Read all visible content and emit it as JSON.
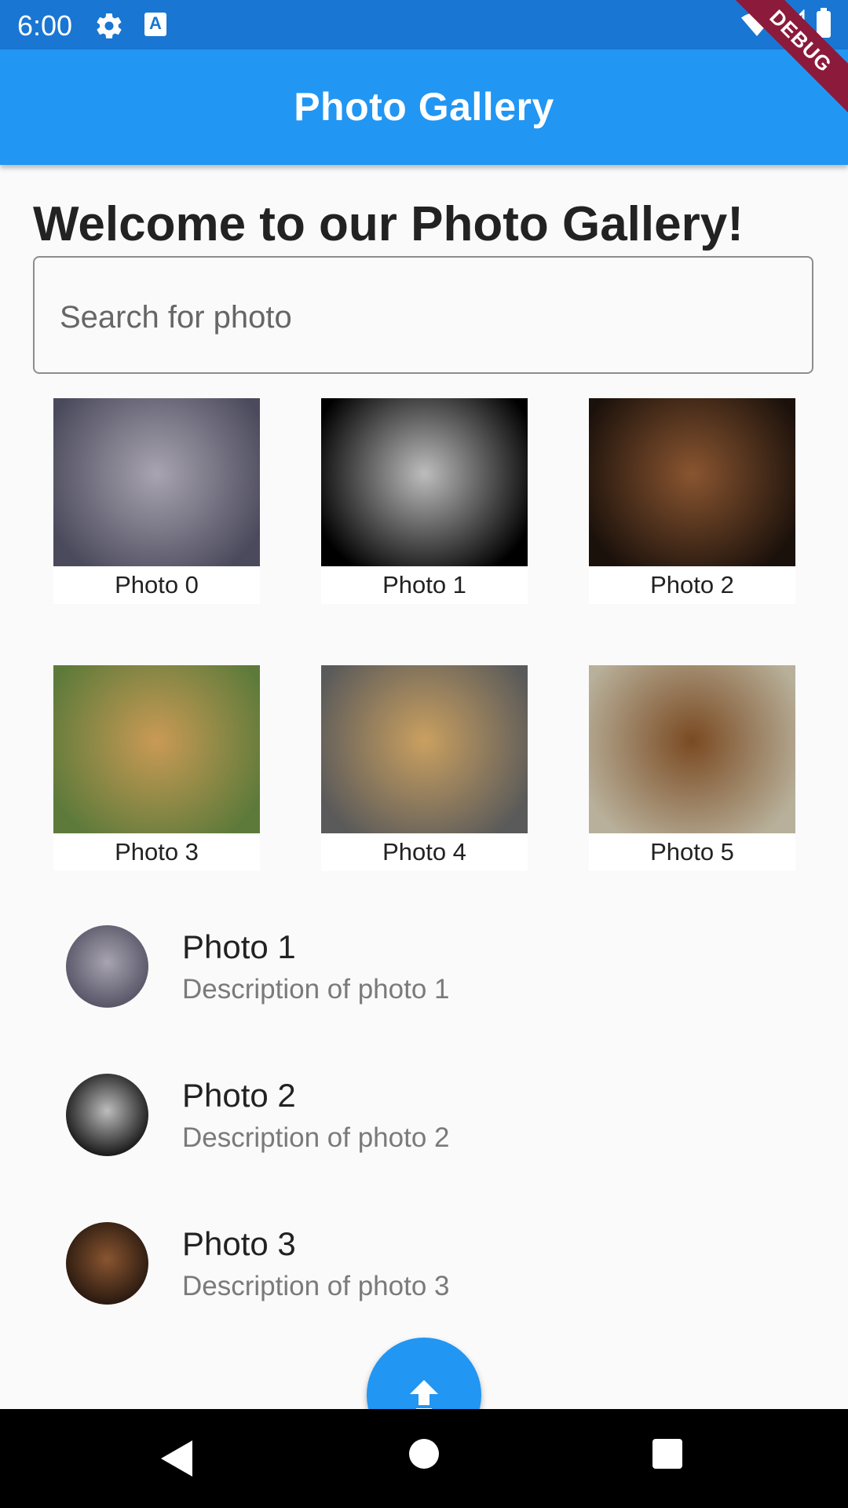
{
  "status_bar": {
    "time": "6:00"
  },
  "app_bar": {
    "title": "Photo Gallery",
    "debug_label": "DEBUG"
  },
  "welcome": "Welcome to our Photo Gallery!",
  "search": {
    "placeholder": "Search for photo",
    "value": ""
  },
  "grid": [
    {
      "label": "Photo 0",
      "tone": [
        "#4b4a5c",
        "#a8a4b0"
      ]
    },
    {
      "label": "Photo 1",
      "tone": [
        "#000000",
        "#bdbdbd"
      ]
    },
    {
      "label": "Photo 2",
      "tone": [
        "#1b110b",
        "#8a5530"
      ]
    },
    {
      "label": "Photo 3",
      "tone": [
        "#5d7a3a",
        "#c99a55"
      ]
    },
    {
      "label": "Photo 4",
      "tone": [
        "#5a5a5a",
        "#caa060"
      ]
    },
    {
      "label": "Photo 5",
      "tone": [
        "#b8b09a",
        "#7a4a22"
      ]
    }
  ],
  "list": [
    {
      "title": "Photo 1",
      "subtitle": "Description of photo 1",
      "tone": [
        "#4b4a5c",
        "#a8a4b0"
      ]
    },
    {
      "title": "Photo 2",
      "subtitle": "Description of photo 2",
      "tone": [
        "#000000",
        "#bdbdbd"
      ]
    },
    {
      "title": "Photo 3",
      "subtitle": "Description of photo 3",
      "tone": [
        "#1b110b",
        "#8a5530"
      ]
    }
  ],
  "fab": {
    "icon": "upload-arrow-icon"
  },
  "colors": {
    "primary": "#2196f3",
    "status_bar": "#1976d2",
    "debug": "#8b1a3b"
  }
}
